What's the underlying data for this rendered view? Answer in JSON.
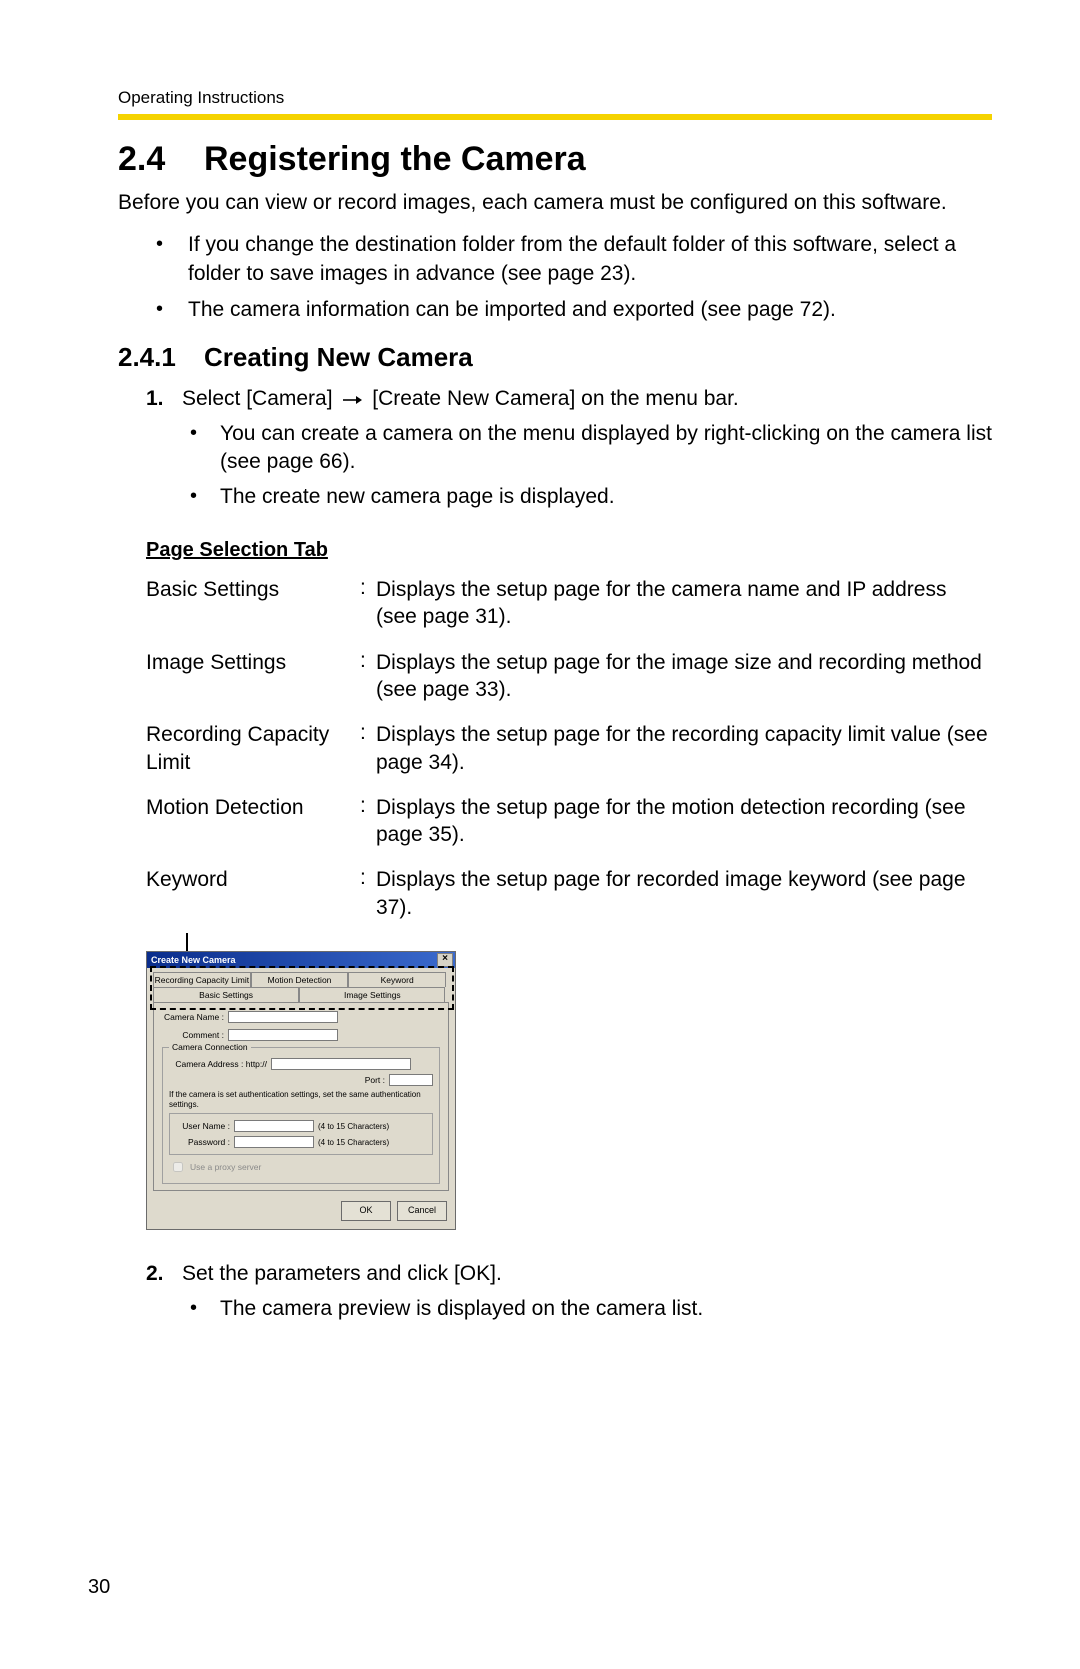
{
  "runningHead": "Operating Instructions",
  "pageNumber": "30",
  "section": {
    "number": "2.4",
    "title": "Registering the Camera",
    "intro": "Before you can view or record images, each camera must be configured on this software.",
    "bullets": [
      "If you change the destination folder from the default folder of this software, select a folder to save images in advance (see page 23).",
      "The camera information can be imported and exported (see page 72)."
    ]
  },
  "subsection": {
    "number": "2.4.1",
    "title": "Creating New Camera"
  },
  "step1": {
    "num": "1.",
    "textBefore": "Select [Camera]",
    "textAfter": "[Create New Camera] on the menu bar.",
    "sub": [
      "You can create a camera on the menu displayed by right-clicking on the camera list (see page 66).",
      "The create new camera page is displayed."
    ]
  },
  "subhead": "Page Selection Tab",
  "defs": [
    {
      "term": "Basic Settings",
      "desc": "Displays the setup page for the camera name and IP address (see page 31)."
    },
    {
      "term": "Image Settings",
      "desc": "Displays the setup page for the image size and recording method (see page 33)."
    },
    {
      "term": "Recording Capacity Limit",
      "desc": "Displays the setup page for the recording capacity limit value (see page 34)."
    },
    {
      "term": "Motion Detection",
      "desc": "Displays the setup page for the motion detection recording (see page 35)."
    },
    {
      "term": "Keyword",
      "desc": "Displays the setup page for recorded image keyword (see page 37)."
    }
  ],
  "dialog": {
    "title": "Create New Camera",
    "tabsRow1": [
      "Recording Capacity Limit",
      "Motion Detection",
      "Keyword"
    ],
    "tabsRow2": [
      "Basic Settings",
      "Image Settings"
    ],
    "cameraNameLabel": "Camera Name :",
    "commentLabel": "Comment :",
    "connectionLegend": "Camera Connection",
    "addressLabel": "Camera Address : http://",
    "portLabel": "Port :",
    "authNote": "If the camera is set authentication settings, set the same authentication settings.",
    "userLabel": "User Name :",
    "passLabel": "Password :",
    "charHint": "(4 to 15 Characters)",
    "proxy": "Use a proxy server",
    "ok": "OK",
    "cancel": "Cancel"
  },
  "step2": {
    "num": "2.",
    "text": "Set the parameters and click [OK].",
    "sub": [
      "The camera preview is displayed on the camera list."
    ]
  }
}
